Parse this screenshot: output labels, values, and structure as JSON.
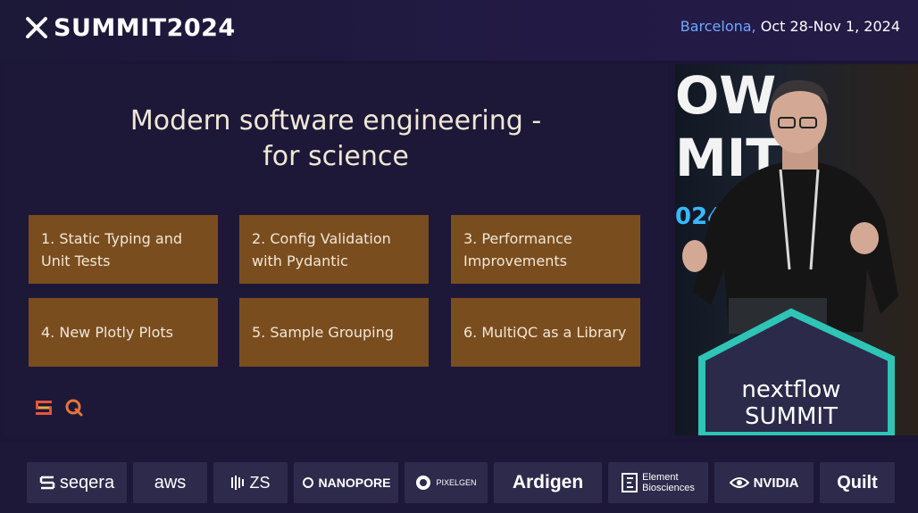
{
  "header": {
    "logo_text": "SUMMIT2024",
    "city": "Barcelona,",
    "dates": " Oct 28-Nov 1, 2024"
  },
  "slide": {
    "title_line1": "Modern software engineering -",
    "title_line2": "for science",
    "cards": [
      {
        "line1": "1. Static Typing and",
        "line2": "Unit Tests"
      },
      {
        "line1": "2. Config Validation",
        "line2": "with Pydantic"
      },
      {
        "line1": "3. Performance",
        "line2": "Improvements"
      },
      {
        "line1": "4. New Plotly Plots",
        "line2": ""
      },
      {
        "line1": "5. Sample Grouping",
        "line2": ""
      },
      {
        "line1": "6. MultiQC as a Library",
        "line2": ""
      }
    ],
    "icons": [
      "seqera-icon",
      "multiqc-icon"
    ]
  },
  "video": {
    "backdrop_line1": "OW",
    "backdrop_line2": "MIT",
    "backdrop_year": "024",
    "podium_line1": "nextflow",
    "podium_line2": "SUMMIT"
  },
  "sponsors": [
    {
      "name": "seqera"
    },
    {
      "name": "aws"
    },
    {
      "name": "ZS"
    },
    {
      "name": "NANOPORE"
    },
    {
      "name": "PIXELGEN"
    },
    {
      "name": "Ardigen"
    },
    {
      "name_line1": "Element",
      "name_line2": "Biosciences"
    },
    {
      "name": "NVIDIA"
    },
    {
      "name": "Quilt"
    }
  ],
  "colors": {
    "background": "#1b1536",
    "card": "#7a4d1f",
    "accent_city": "#6fa8ff",
    "podium_teal": "#2ec4b6"
  }
}
